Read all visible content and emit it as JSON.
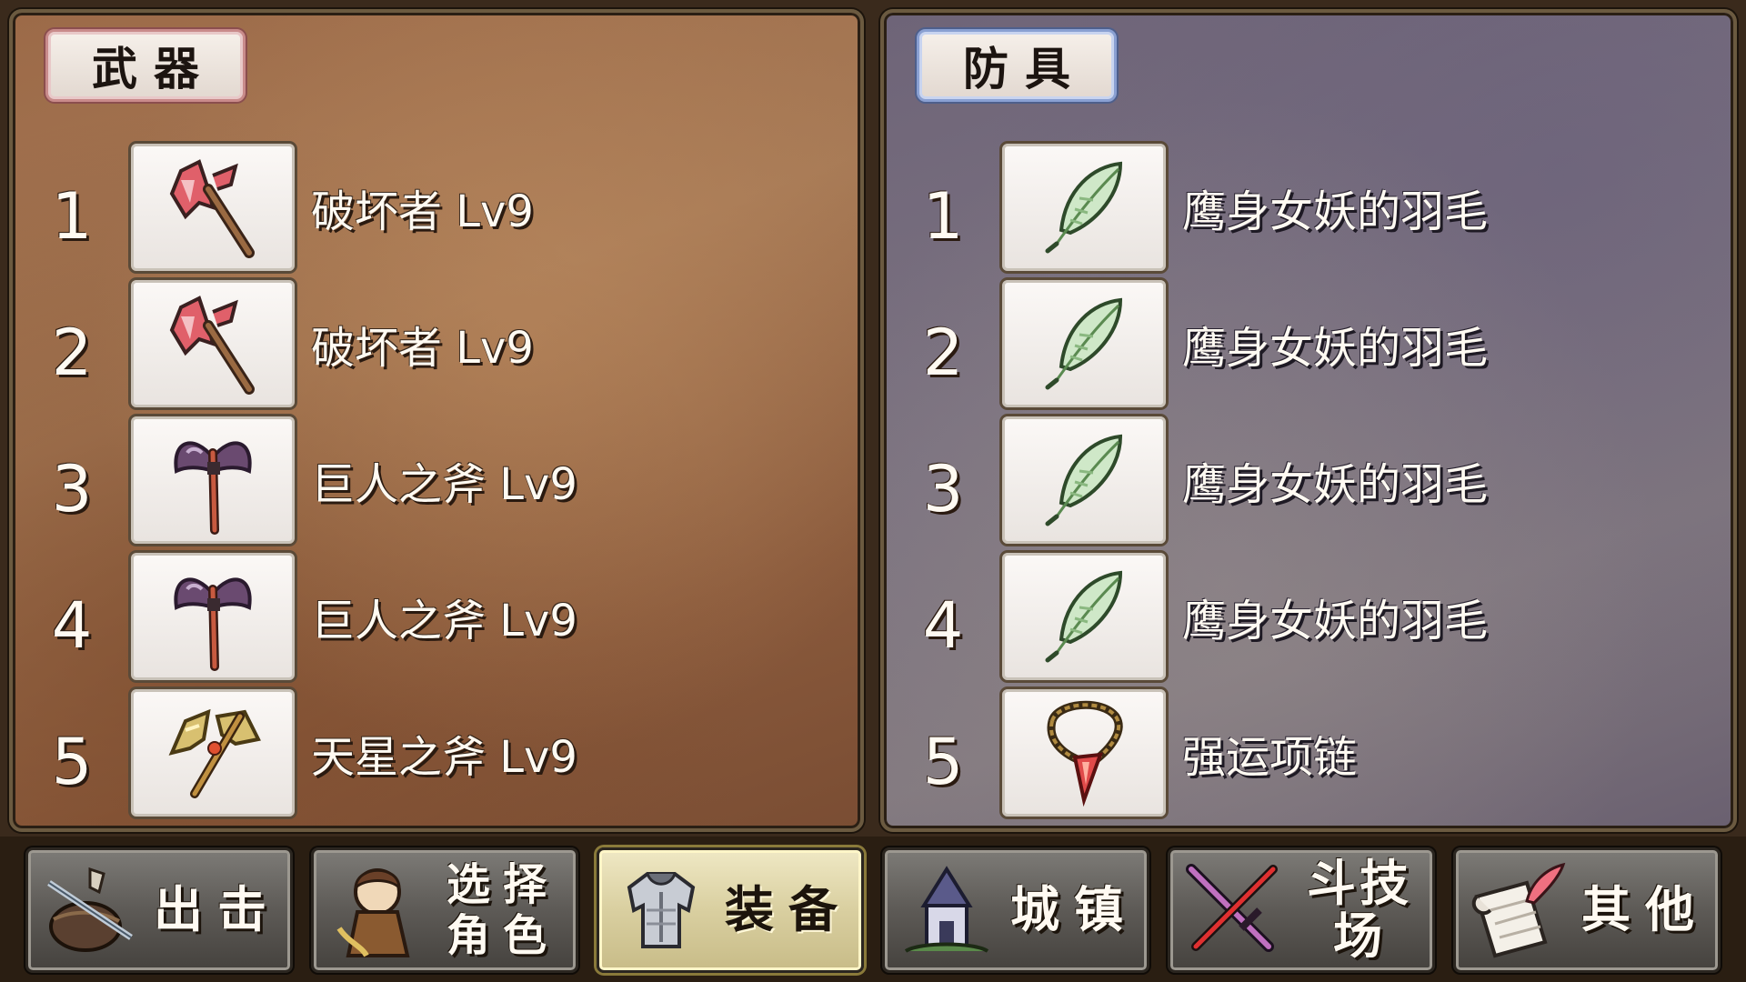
{
  "weapons": {
    "title": "武器",
    "items": [
      {
        "num": "1",
        "name": "破坏者 Lv9",
        "icon": "red-axe-icon"
      },
      {
        "num": "2",
        "name": "破坏者 Lv9",
        "icon": "red-axe-icon"
      },
      {
        "num": "3",
        "name": "巨人之斧 Lv9",
        "icon": "giant-axe-icon"
      },
      {
        "num": "4",
        "name": "巨人之斧 Lv9",
        "icon": "giant-axe-icon"
      },
      {
        "num": "5",
        "name": "天星之斧 Lv9",
        "icon": "golden-axe-icon"
      }
    ]
  },
  "armor": {
    "title": "防具",
    "items": [
      {
        "num": "1",
        "name": "鹰身女妖的羽毛",
        "icon": "feather-icon"
      },
      {
        "num": "2",
        "name": "鹰身女妖的羽毛",
        "icon": "feather-icon"
      },
      {
        "num": "3",
        "name": "鹰身女妖的羽毛",
        "icon": "feather-icon"
      },
      {
        "num": "4",
        "name": "鹰身女妖的羽毛",
        "icon": "feather-icon"
      },
      {
        "num": "5",
        "name": "强运项链",
        "icon": "necklace-icon"
      }
    ]
  },
  "nav": {
    "sortie": "出击",
    "select_line1": "选择",
    "select_line2": "角色",
    "equip": "装备",
    "town": "城镇",
    "arena": "斗技场",
    "other": "其他",
    "active": "equip"
  }
}
